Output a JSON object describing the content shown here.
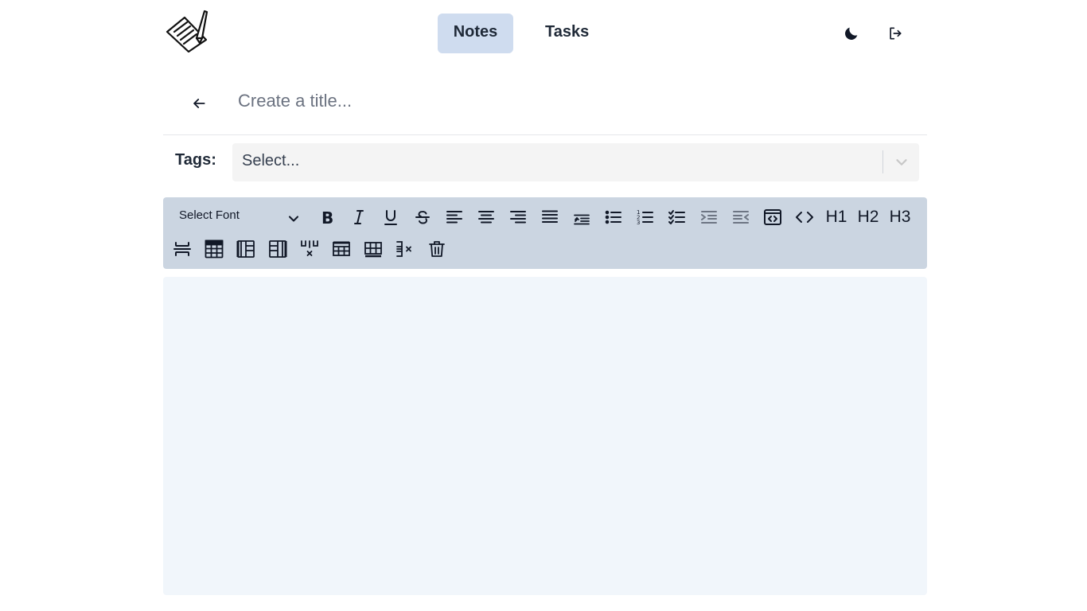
{
  "app": {
    "logo_icon": "notepad-pencil-icon"
  },
  "nav": {
    "tabs": [
      {
        "label": "Notes",
        "active": true
      },
      {
        "label": "Tasks",
        "active": false
      }
    ]
  },
  "header_actions": {
    "theme_icon": "moon-icon",
    "logout_icon": "logout-icon"
  },
  "editor_header": {
    "back_icon": "arrow-left-icon",
    "title_placeholder": "Create a title...",
    "title_value": ""
  },
  "tags": {
    "label": "Tags:",
    "placeholder": "Select..."
  },
  "toolbar": {
    "font_select_label": "Select Font",
    "buttons": [
      {
        "name": "bold",
        "icon": "bold-icon"
      },
      {
        "name": "italic",
        "icon": "italic-icon"
      },
      {
        "name": "underline",
        "icon": "underline-icon"
      },
      {
        "name": "strikethrough",
        "icon": "strikethrough-icon"
      },
      {
        "name": "align-left",
        "icon": "align-left-icon"
      },
      {
        "name": "align-center",
        "icon": "align-center-icon"
      },
      {
        "name": "align-right",
        "icon": "align-right-icon"
      },
      {
        "name": "align-justify",
        "icon": "align-justify-icon"
      },
      {
        "name": "blockquote",
        "icon": "quote-icon"
      },
      {
        "name": "bullet-list",
        "icon": "bullet-list-icon"
      },
      {
        "name": "ordered-list",
        "icon": "ordered-list-icon"
      },
      {
        "name": "task-list",
        "icon": "checklist-icon"
      },
      {
        "name": "indent",
        "icon": "indent-icon"
      },
      {
        "name": "outdent",
        "icon": "outdent-icon"
      },
      {
        "name": "code-block",
        "icon": "code-block-icon"
      },
      {
        "name": "inline-code",
        "icon": "code-icon"
      },
      {
        "name": "heading-1",
        "label": "H1"
      },
      {
        "name": "heading-2",
        "label": "H2"
      },
      {
        "name": "heading-3",
        "label": "H3"
      },
      {
        "name": "horizontal-rule",
        "icon": "horizontal-rule-icon"
      },
      {
        "name": "insert-table",
        "icon": "table-icon"
      },
      {
        "name": "add-column-before",
        "icon": "column-before-icon"
      },
      {
        "name": "add-column-after",
        "icon": "column-after-icon"
      },
      {
        "name": "delete-column",
        "icon": "delete-column-icon"
      },
      {
        "name": "add-row-before",
        "icon": "row-before-icon"
      },
      {
        "name": "add-row-after",
        "icon": "row-after-icon"
      },
      {
        "name": "delete-row",
        "icon": "delete-row-icon"
      },
      {
        "name": "delete-table",
        "icon": "trash-icon"
      }
    ]
  },
  "editor": {
    "content": ""
  }
}
